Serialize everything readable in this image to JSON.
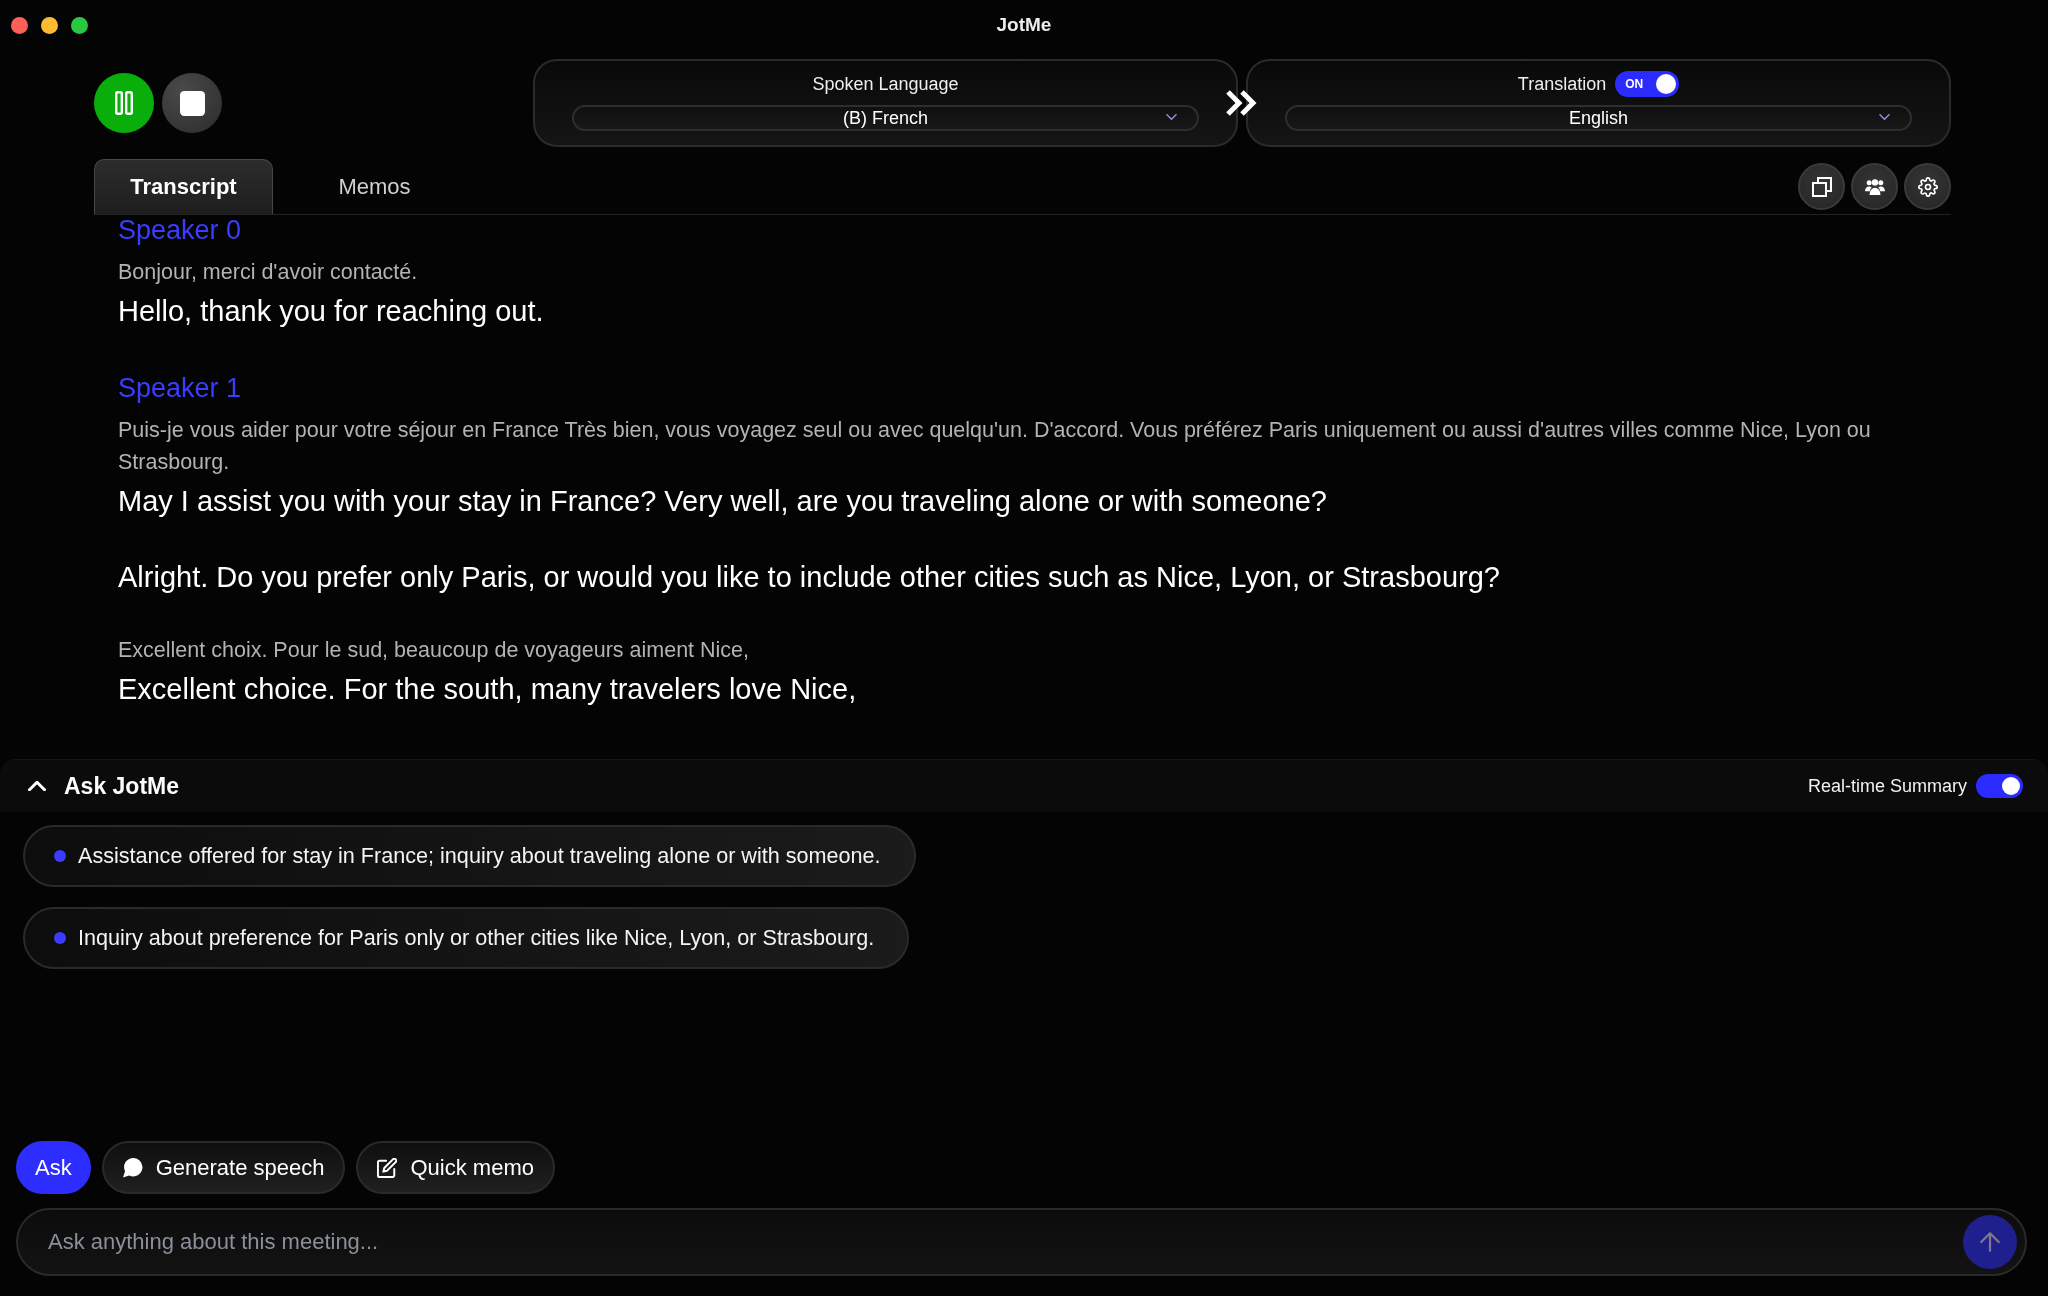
{
  "window": {
    "title": "JotMe"
  },
  "recording_controls": [
    {
      "kind": "pause"
    },
    {
      "kind": "stop"
    }
  ],
  "spoken_language": {
    "label": "Spoken Language",
    "value": "(B) French"
  },
  "translation": {
    "label": "Translation",
    "on": true,
    "toggle_label": "ON",
    "value": "English"
  },
  "tabs": [
    {
      "label": "Transcript",
      "selected": true
    },
    {
      "label": "Memos",
      "selected": false
    }
  ],
  "toolbar": [
    {
      "kind": "copy"
    },
    {
      "kind": "speakers"
    },
    {
      "kind": "settings"
    }
  ],
  "transcript": [
    {
      "speaker": "Speaker 0",
      "segments": [
        {
          "original": "Bonjour, merci d'avoir contacté.",
          "translation": "Hello, thank you for reaching out."
        }
      ]
    },
    {
      "speaker": "Speaker 1",
      "segments": [
        {
          "original": "Puis-je vous aider pour votre séjour en France Très bien, vous voyagez seul ou avec quelqu'un. D'accord. Vous préférez Paris uniquement ou aussi d'autres villes comme Nice, Lyon ou Strasbourg.",
          "translation": "May I assist you with your stay in France? Very well, are you traveling alone or with someone?"
        },
        {
          "translation": "Alright. Do you prefer only Paris, or would you like to include other cities such as Nice, Lyon, or Strasbourg?"
        },
        {
          "original": "Excellent choix. Pour le sud, beaucoup de voyageurs aiment Nice,",
          "translation": "Excellent choice. For the south, many travelers love Nice,"
        }
      ]
    }
  ],
  "ask_panel": {
    "title": "Ask JotMe",
    "expanded": true,
    "realtime_summary": {
      "label": "Real-time Summary",
      "on": true
    },
    "summary": [
      "Assistance offered for stay in France; inquiry about traveling alone or with someone.",
      "Inquiry about preference for Paris only or other cities like Nice, Lyon, or Strasbourg."
    ]
  },
  "actions": [
    {
      "label": "Ask",
      "kind": "ask",
      "selected": true
    },
    {
      "label": "Generate speech",
      "kind": "speech",
      "selected": false
    },
    {
      "label": "Quick memo",
      "kind": "memo",
      "selected": false
    }
  ],
  "input": {
    "placeholder": "Ask anything about this meeting..."
  },
  "send": {
    "disabled": true
  }
}
